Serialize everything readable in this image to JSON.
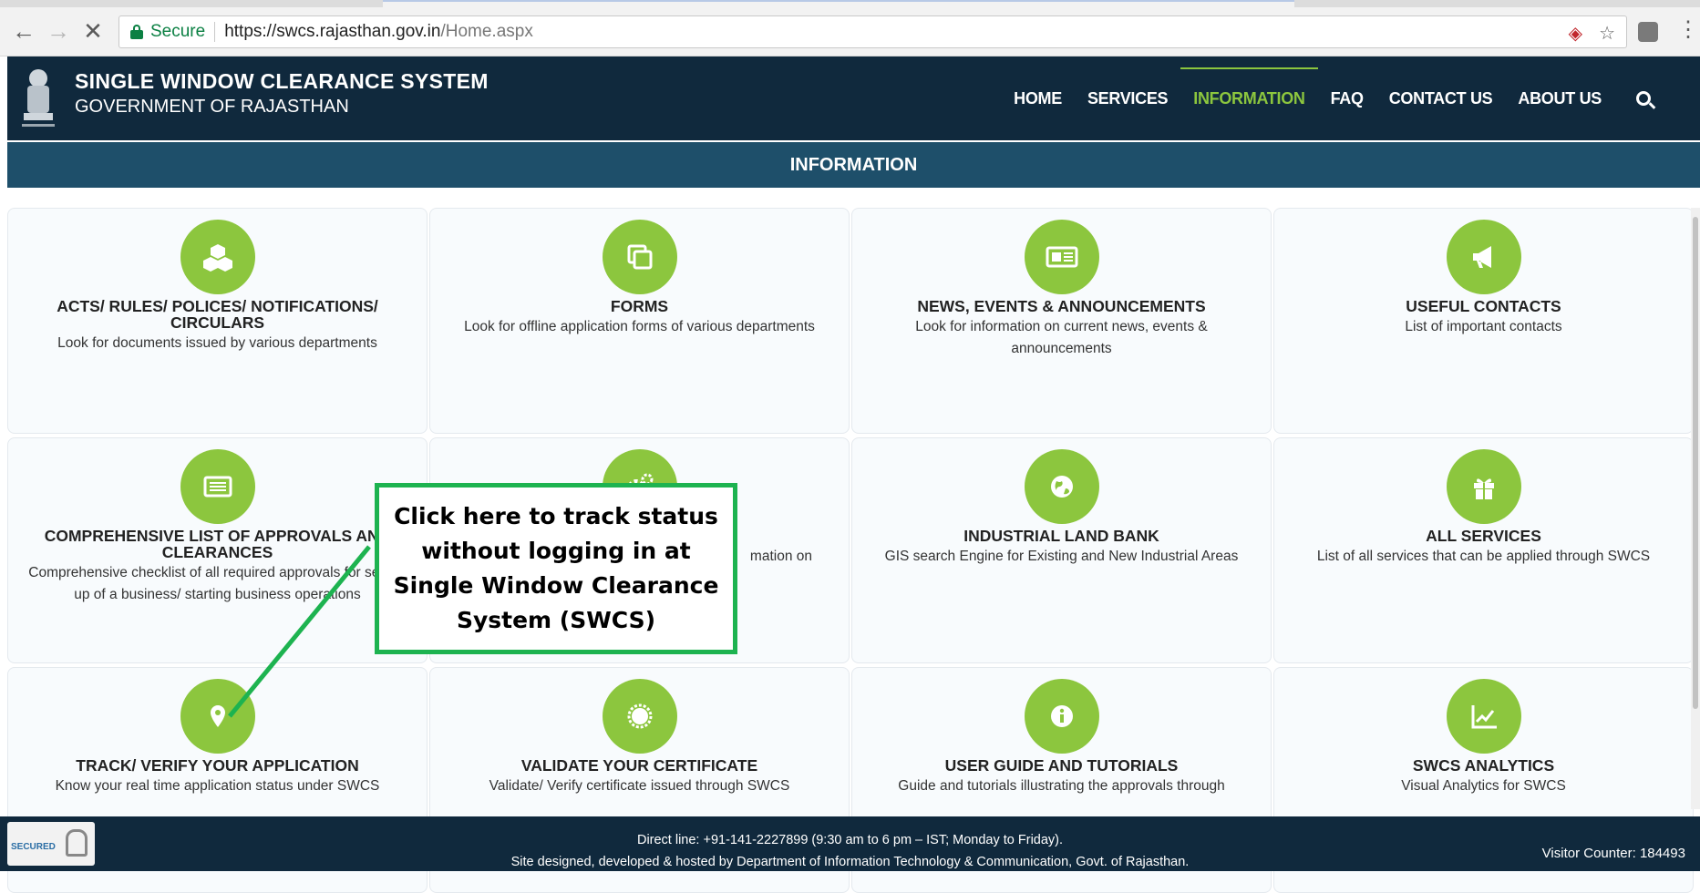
{
  "browser": {
    "secure_label": "Secure",
    "url_host": "https://swcs.rajasthan.gov.in",
    "url_path": "/Home.aspx"
  },
  "header": {
    "title": "SINGLE WINDOW CLEARANCE SYSTEM",
    "subtitle": "GOVERNMENT OF RAJASTHAN",
    "nav": [
      "HOME",
      "SERVICES",
      "INFORMATION",
      "FAQ",
      "CONTACT US",
      "ABOUT US"
    ],
    "active_nav": "INFORMATION"
  },
  "section_title": "INFORMATION",
  "cards": [
    {
      "title": "ACTS/ RULES/ POLICES/ NOTIFICATIONS/ CIRCULARS",
      "desc": "Look for documents issued by various departments",
      "icon": "cubes-icon"
    },
    {
      "title": "FORMS",
      "desc": "Look for offline application forms of various departments",
      "icon": "copy-icon"
    },
    {
      "title": "NEWS, EVENTS & ANNOUNCEMENTS",
      "desc": "Look for information on current news, events & announcements",
      "icon": "newspaper-icon"
    },
    {
      "title": "USEFUL CONTACTS",
      "desc": "List of important contacts",
      "icon": "bullhorn-icon"
    },
    {
      "title": "COMPREHENSIVE LIST OF APPROVALS AND CLEARANCES",
      "desc": "Comprehensive checklist of all required approvals for setting up of a business/ starting business operations",
      "icon": "list-icon"
    },
    {
      "title": "",
      "desc": "mation on",
      "icon": "gears-icon"
    },
    {
      "title": "INDUSTRIAL LAND BANK",
      "desc": "GIS search Engine for Existing and New Industrial Areas",
      "icon": "globe-icon"
    },
    {
      "title": "ALL SERVICES",
      "desc": "List of all services that can be applied through SWCS",
      "icon": "gift-icon"
    },
    {
      "title": "TRACK/ VERIFY YOUR APPLICATION",
      "desc": "Know your real time application status under SWCS",
      "icon": "map-marker-icon"
    },
    {
      "title": "VALIDATE YOUR CERTIFICATE",
      "desc": "Validate/ Verify certificate issued through SWCS",
      "icon": "certificate-icon"
    },
    {
      "title": "USER GUIDE AND TUTORIALS",
      "desc": "Guide and tutorials illustrating the approvals through",
      "icon": "info-icon"
    },
    {
      "title": "SWCS ANALYTICS",
      "desc": "Visual Analytics for SWCS",
      "icon": "chart-icon"
    }
  ],
  "callout": {
    "text": "Click here to track status without logging in at Single Window Clearance System (SWCS)",
    "color": "#1db350"
  },
  "footer": {
    "line1": "Direct line: +91-141-2227899 (9:30 am to 6 pm – IST; Monday to Friday).",
    "line2": "Site designed, developed & hosted by Department of Information Technology & Communication, Govt. of Rajasthan.",
    "visitor": "Visitor Counter: 184493",
    "badge": "SECURED"
  },
  "colors": {
    "brand_dark": "#10293d",
    "accent_green": "#8cc63e",
    "section_bar": "#1e4f6a"
  }
}
